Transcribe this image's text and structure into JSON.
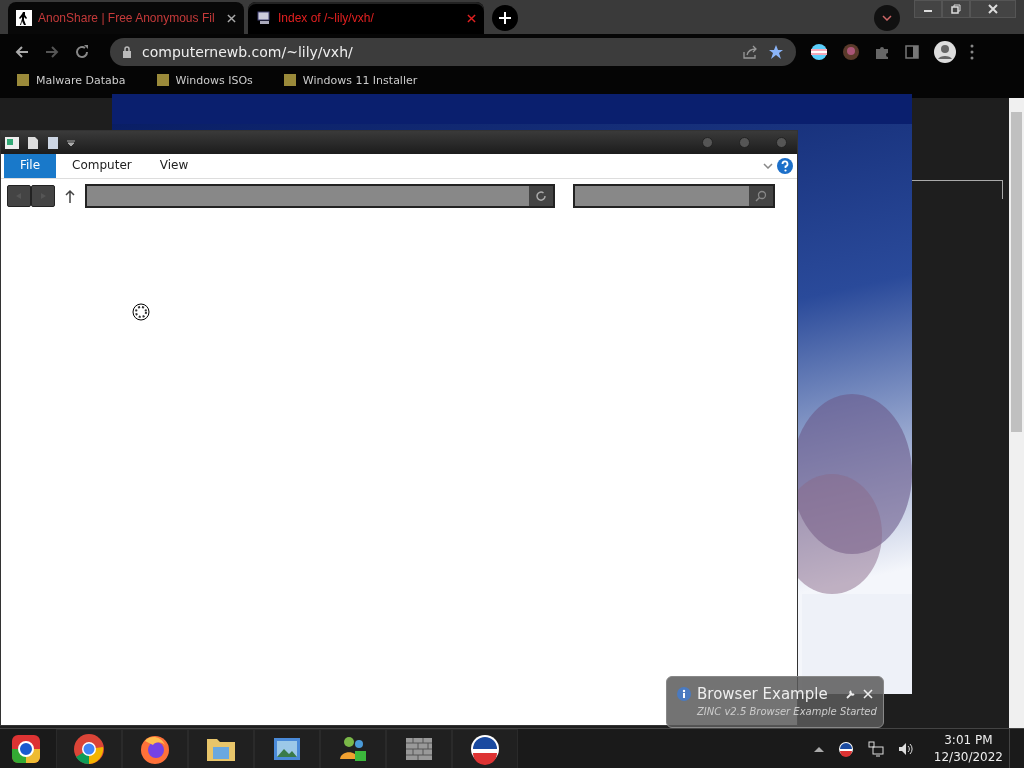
{
  "browser": {
    "tabs": [
      {
        "title": "AnonShare | Free Anonymous Fil",
        "selected": false
      },
      {
        "title": "Index of /~lily/vxh/",
        "selected": true
      }
    ],
    "url": "computernewb.com/~lily/vxh/",
    "bookmarks": [
      {
        "title": "Malware Databa"
      },
      {
        "title": "Windows ISOs"
      },
      {
        "title": "Windows 11 Installer"
      }
    ]
  },
  "explorer": {
    "menu": [
      {
        "label": "File",
        "selected": true
      },
      {
        "label": "Computer",
        "selected": false
      },
      {
        "label": "View",
        "selected": false
      }
    ]
  },
  "notification": {
    "title": "Browser Example",
    "message": "ZINC v2.5 Browser Example Started"
  },
  "clock": {
    "time": "3:01 PM",
    "date": "12/30/2022"
  }
}
